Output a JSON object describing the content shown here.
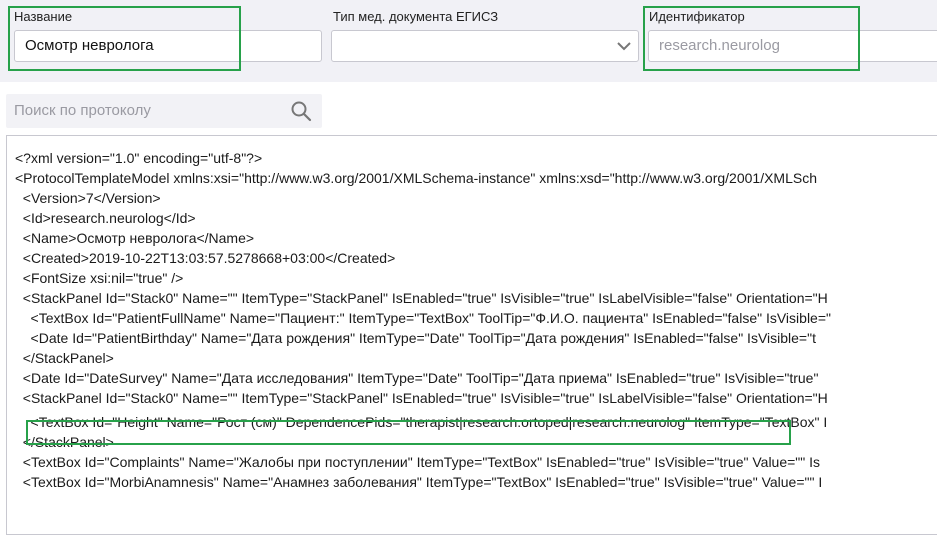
{
  "form": {
    "name": {
      "label": "Название",
      "value": "Осмотр невролога"
    },
    "doc_type": {
      "label": "Тип мед. документа ЕГИСЗ",
      "value": ""
    },
    "identifier": {
      "label": "Идентификатор",
      "placeholder": "research.neurolog"
    }
  },
  "search": {
    "placeholder": "Поиск по протоколу",
    "icon": "search-icon"
  },
  "editor": {
    "lines": [
      "<?xml version=\"1.0\" encoding=\"utf-8\"?>",
      "<ProtocolTemplateModel xmlns:xsi=\"http://www.w3.org/2001/XMLSchema-instance\" xmlns:xsd=\"http://www.w3.org/2001/XMLSch",
      "  <Version>7</Version>",
      "  <Id>research.neurolog</Id>",
      "  <Name>Осмотр невролога</Name>",
      "  <Created>2019-10-22T13:03:57.5278668+03:00</Created>",
      "  <FontSize xsi:nil=\"true\" />",
      "  <StackPanel Id=\"Stack0\" Name=\"\" ItemType=\"StackPanel\" IsEnabled=\"true\" IsVisible=\"true\" IsLabelVisible=\"false\" Orientation=\"H",
      "    <TextBox Id=\"PatientFullName\" Name=\"Пациент:\" ItemType=\"TextBox\" ToolTip=\"Ф.И.О. пациента\" IsEnabled=\"false\" IsVisible=\"",
      "    <Date Id=\"PatientBirthday\" Name=\"Дата рождения\" ItemType=\"Date\" ToolTip=\"Дата рождения\" IsEnabled=\"false\" IsVisible=\"t",
      "  </StackPanel>",
      "  <Date Id=\"DateSurvey\" Name=\"Дата исследования\" ItemType=\"Date\" ToolTip=\"Дата приема\" IsEnabled=\"true\" IsVisible=\"true\"",
      "  <StackPanel Id=\"Stack0\" Name=\"\" ItemType=\"StackPanel\" IsEnabled=\"true\" IsVisible=\"true\" IsLabelVisible=\"false\" Orientation=\"H",
      "    <TextBox Id=\"Height\" Name=\"Рост (см)\" DependencePids=\"therapist|research.ortoped|research.neurolog\" ItemType=\"TextBox\" I",
      "  </StackPanel>",
      "  <TextBox Id=\"Complaints\" Name=\"Жалобы при поступлении\" ItemType=\"TextBox\" IsEnabled=\"true\" IsVisible=\"true\" Value=\"\" Is",
      "  <TextBox Id=\"MorbiAnamnesis\" Name=\"Анамнез заболевания\" ItemType=\"TextBox\" IsEnabled=\"true\" IsVisible=\"true\" Value=\"\" I"
    ]
  },
  "colors": {
    "highlight": "#27a14a",
    "panel_bg": "#f1f1f6"
  }
}
